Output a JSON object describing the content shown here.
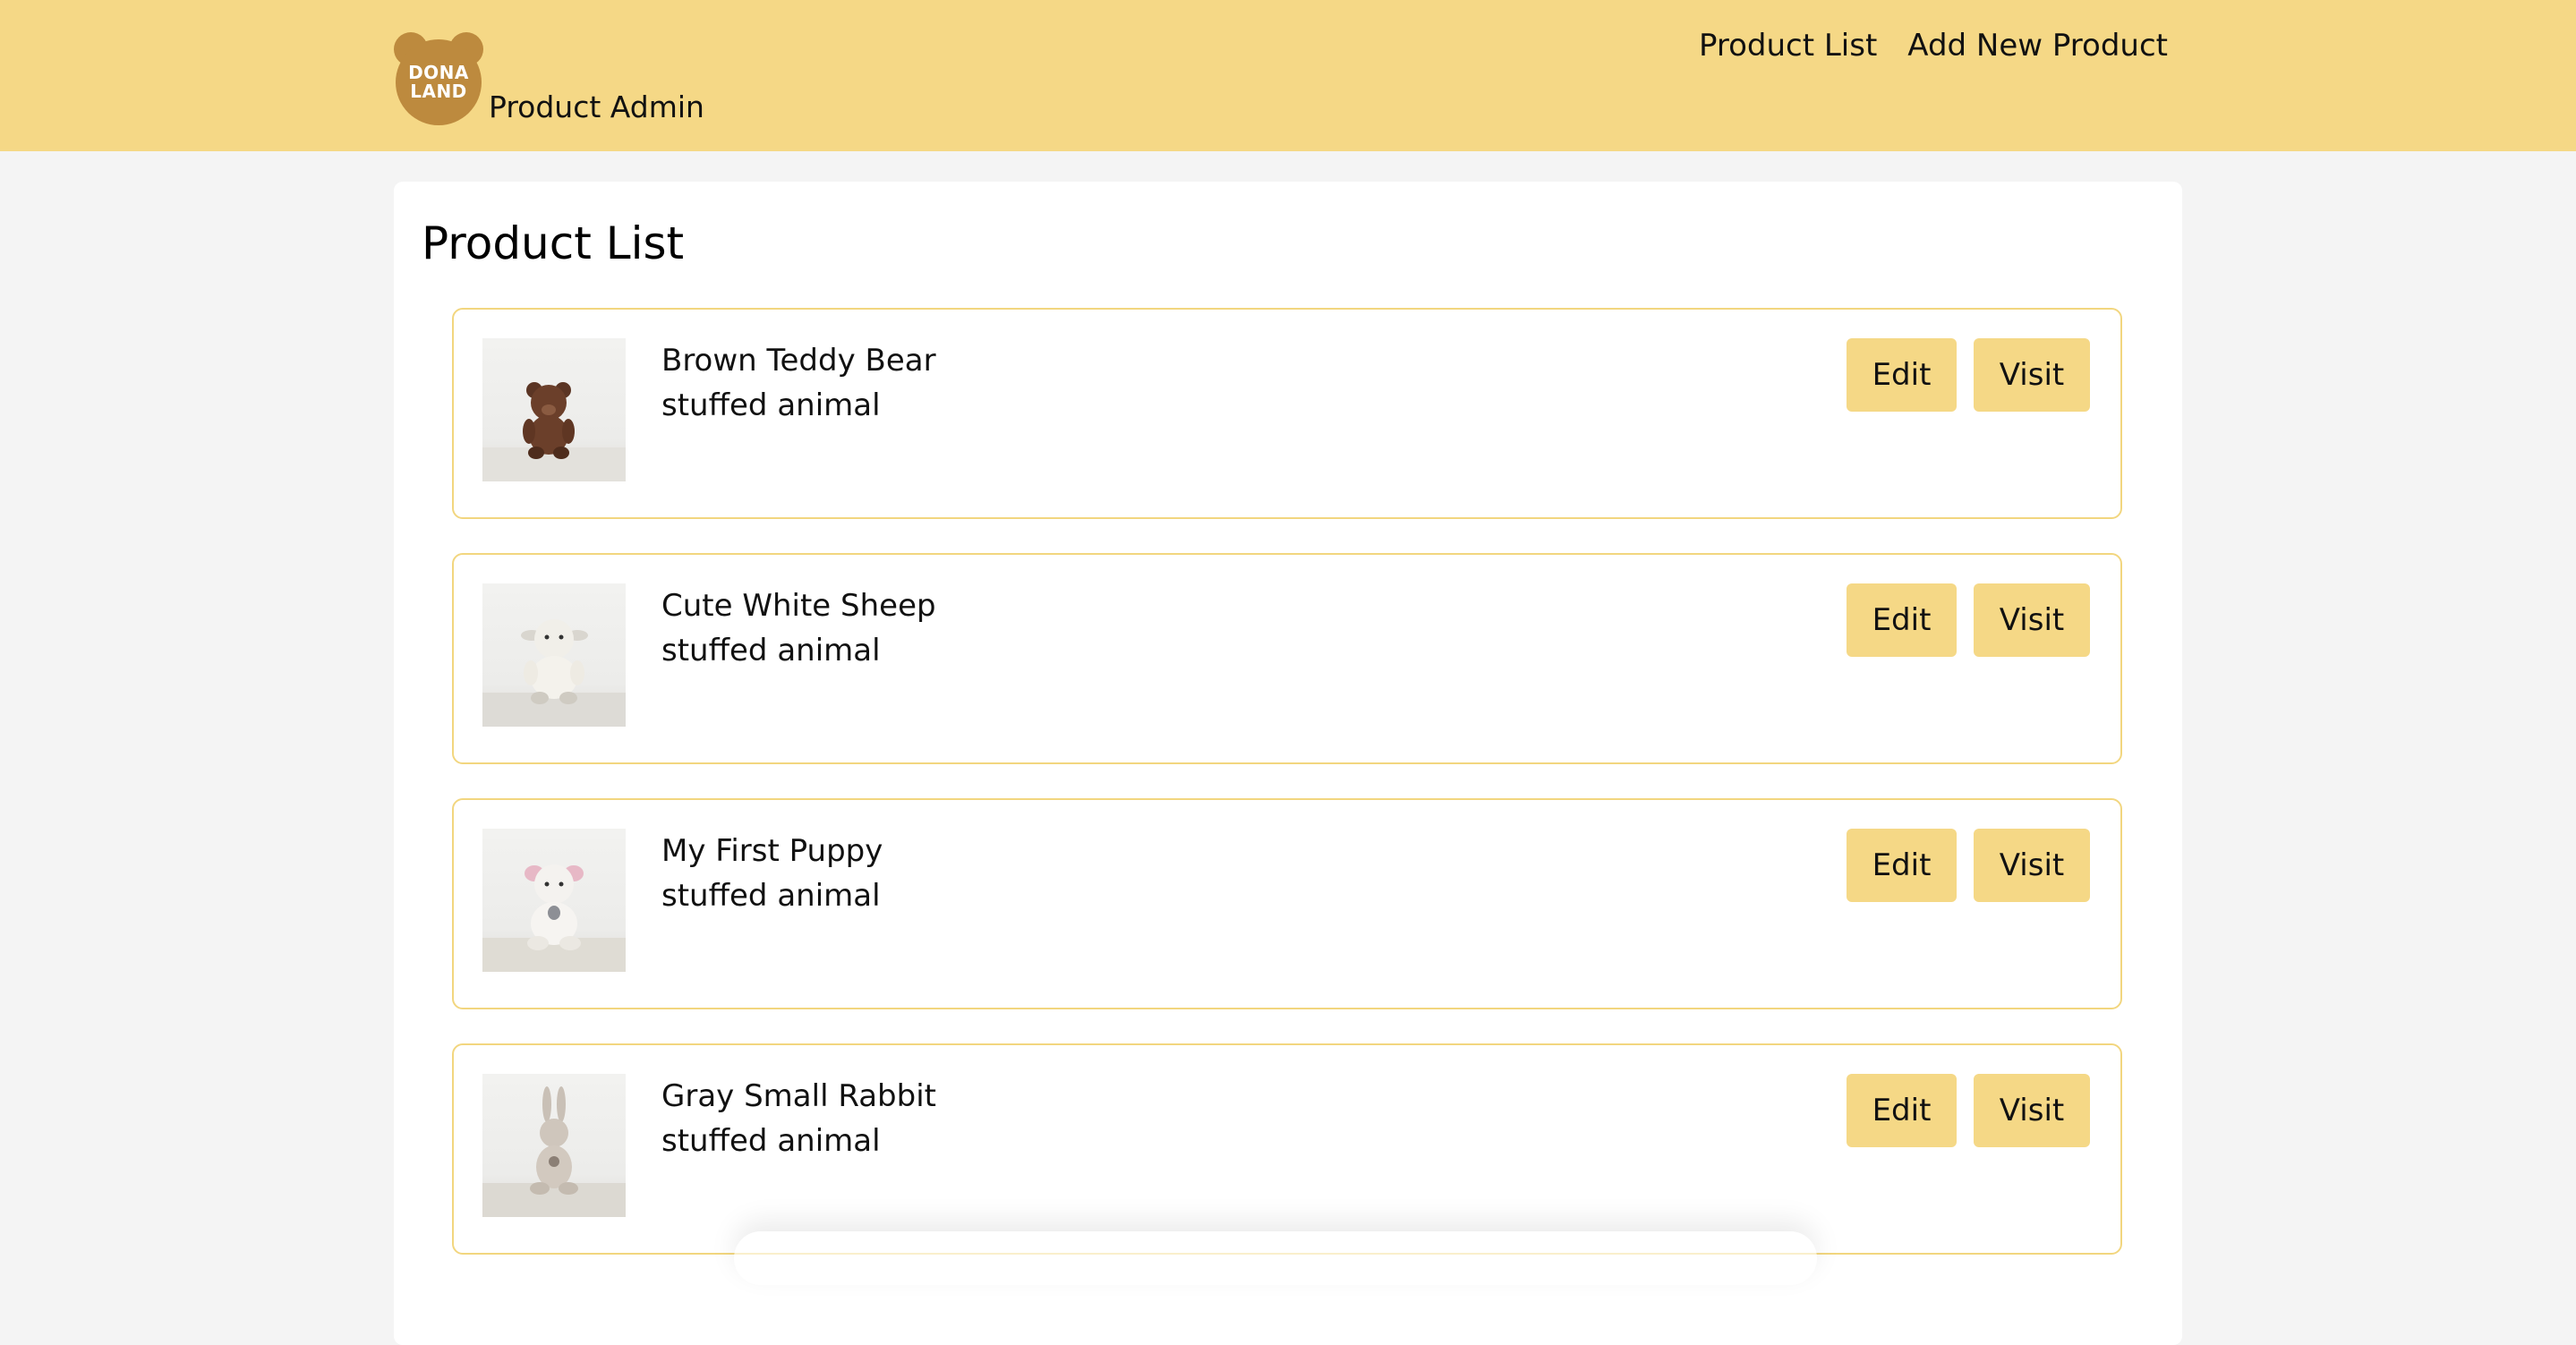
{
  "brand": {
    "logo_line1": "DONA",
    "logo_line2": "LAND",
    "title": "Product Admin"
  },
  "nav": {
    "items": [
      {
        "label": "Product List"
      },
      {
        "label": "Add New Product"
      }
    ]
  },
  "main": {
    "title": "Product List",
    "products": [
      {
        "name": "Brown Teddy Bear",
        "category": "stuffed animal",
        "edit_label": "Edit",
        "visit_label": "Visit",
        "image_icon": "teddy-bear"
      },
      {
        "name": "Cute White Sheep",
        "category": "stuffed animal",
        "edit_label": "Edit",
        "visit_label": "Visit",
        "image_icon": "sheep"
      },
      {
        "name": "My First Puppy",
        "category": "stuffed animal",
        "edit_label": "Edit",
        "visit_label": "Visit",
        "image_icon": "puppy"
      },
      {
        "name": "Gray Small Rabbit",
        "category": "stuffed animal",
        "edit_label": "Edit",
        "visit_label": "Visit",
        "image_icon": "rabbit"
      }
    ]
  },
  "colors": {
    "header_bg": "#f5d886",
    "accent": "#f5d886",
    "card_border": "#f2d67f",
    "logo": "#bd8a3e",
    "page_bg": "#f4f4f4"
  }
}
